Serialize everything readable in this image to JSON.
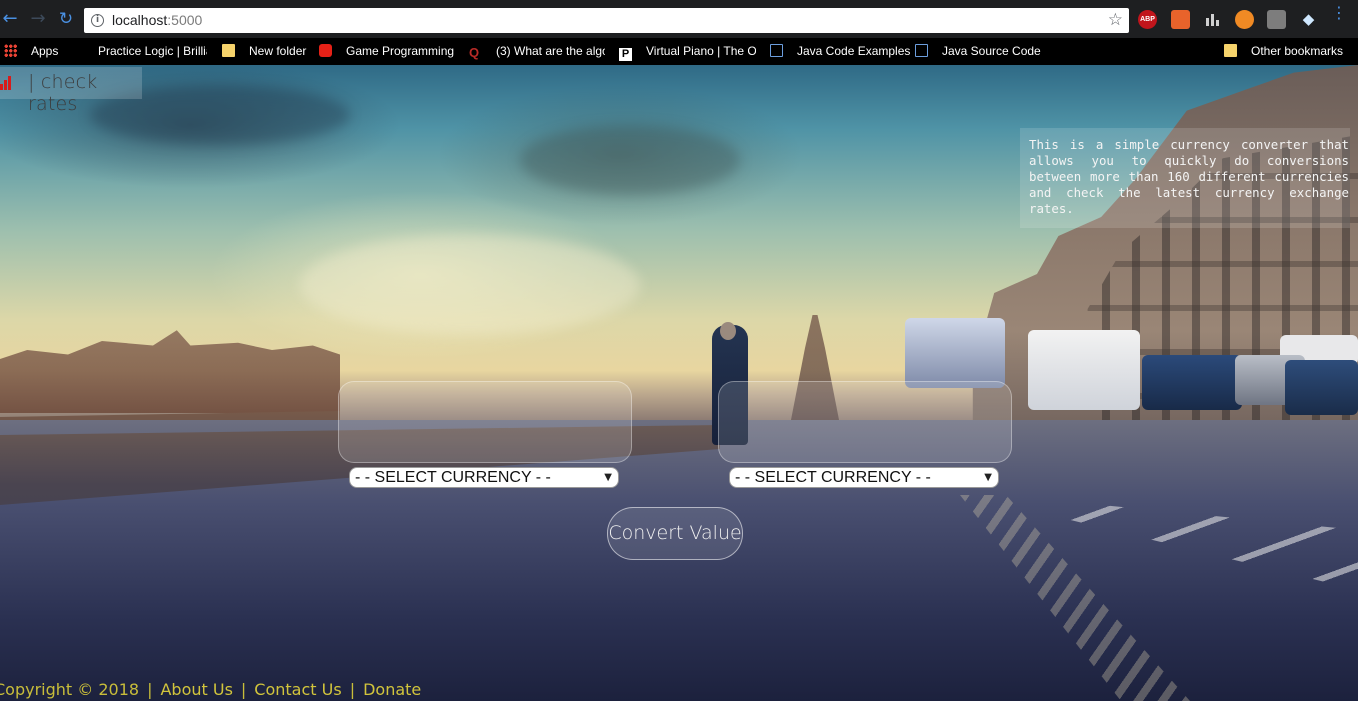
{
  "browser": {
    "url_host": "localhost",
    "url_port": ":5000",
    "bookmarks": [
      {
        "label": "Apps",
        "icon": "apps-grid-icon"
      },
      {
        "label": "Practice Logic | Brillia",
        "icon": "brilliant-icon"
      },
      {
        "label": "New folder",
        "icon": "folder-icon"
      },
      {
        "label": "Game Programming",
        "icon": "youtube-icon"
      },
      {
        "label": "(3) What are the algo",
        "icon": "quora-icon"
      },
      {
        "label": "Virtual Piano | The O",
        "icon": "p-icon"
      },
      {
        "label": "Java Code Examples",
        "icon": "page-icon"
      },
      {
        "label": "Java Source Code",
        "icon": "page-icon"
      },
      {
        "label": "Other bookmarks",
        "icon": "folder-icon"
      }
    ],
    "extensions": {
      "abp_label": "ABP"
    }
  },
  "app": {
    "logo_text": "| check rates",
    "about_text": "This is a simple currency converter that allows you to quickly do conversions between more than 160 different currencies and check the latest currency exchange rates.",
    "from_select": "- - SELECT CURRENCY - -",
    "to_select": "- - SELECT CURRENCY - -",
    "convert_label": "Convert Value",
    "footer": {
      "copyright": "Copyright © 2018",
      "about": "About Us",
      "contact": "Contact Us",
      "donate": "Donate",
      "separator": "|"
    }
  },
  "colors": {
    "logo_accent": "#d81b1b",
    "footer_text": "#d1c43c"
  }
}
